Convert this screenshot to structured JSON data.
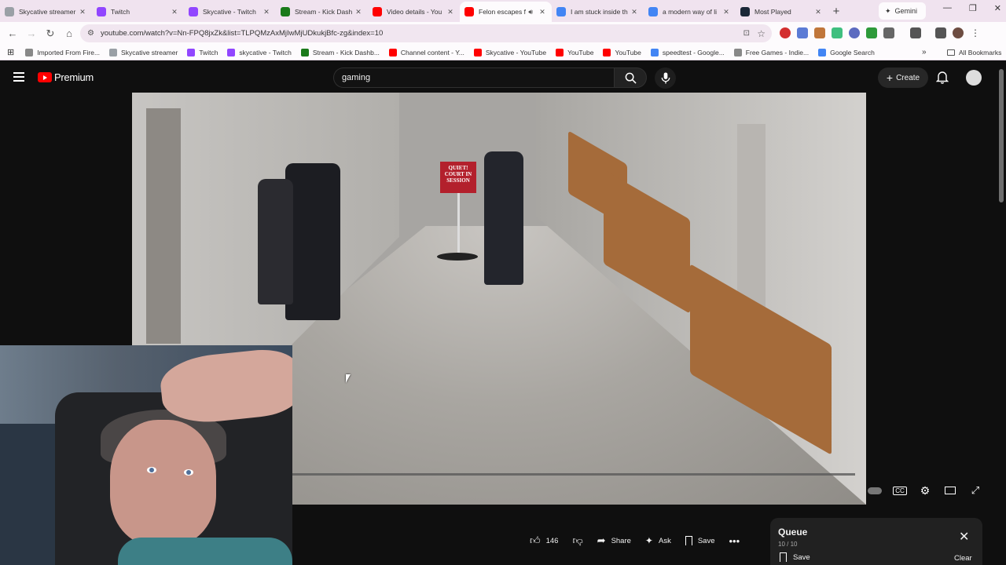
{
  "browser": {
    "tabs": [
      {
        "label": "Skycative streamer",
        "icon": "globe-icon",
        "color": "#9aa0a6"
      },
      {
        "label": "Twitch",
        "icon": "twitch-icon",
        "color": "#9146ff"
      },
      {
        "label": "Skycative - Twitch",
        "icon": "twitch-icon",
        "color": "#9146ff"
      },
      {
        "label": "Stream - Kick Dash",
        "icon": "kick-icon",
        "color": "#1a7a1a"
      },
      {
        "label": "Video details - You",
        "icon": "youtube-icon",
        "color": "#ff0000"
      },
      {
        "label": "Felon escapes f",
        "icon": "youtube-icon",
        "color": "#ff0000"
      },
      {
        "label": "I am stuck inside th",
        "icon": "google-icon",
        "color": "#4285f4"
      },
      {
        "label": "a modern way of li",
        "icon": "google-icon",
        "color": "#4285f4"
      },
      {
        "label": "Most Played",
        "icon": "steam-icon",
        "color": "#1b2838"
      }
    ],
    "gemini_label": "Gemini",
    "url": "youtube.com/watch?v=Nn-FPQ8jxZk&list=TLPQMzAxMjIwMjUDkukjBfc-zg&index=10",
    "bookmarks": [
      {
        "label": "Imported From Fire...",
        "color": "#888888"
      },
      {
        "label": "Skycative streamer",
        "color": "#9aa0a6"
      },
      {
        "label": "Twitch",
        "color": "#9146ff"
      },
      {
        "label": "skycative - Twitch",
        "color": "#9146ff"
      },
      {
        "label": "Stream - Kick Dashb...",
        "color": "#1a7a1a"
      },
      {
        "label": "Channel content - Y...",
        "color": "#ff0000"
      },
      {
        "label": "Skycative - YouTube",
        "color": "#ff0000"
      },
      {
        "label": "YouTube",
        "color": "#ff0000"
      },
      {
        "label": "YouTube",
        "color": "#ff0000"
      },
      {
        "label": "speedtest - Google...",
        "color": "#4285f4"
      },
      {
        "label": "Free Games - Indie...",
        "color": "#888888"
      },
      {
        "label": "Google Search",
        "color": "#4285f4"
      }
    ],
    "all_bookmarks": "All Bookmarks"
  },
  "youtube": {
    "logo_text": "Premium",
    "search_value": "gaming",
    "create_label": "Create",
    "video": {
      "sign_text": "QUIET! COURT IN SESSION"
    },
    "actions": {
      "likes": "146",
      "share": "Share",
      "ask": "Ask",
      "save": "Save"
    },
    "queue": {
      "title": "Queue",
      "count": "10 / 10",
      "save": "Save",
      "clear": "Clear"
    }
  }
}
